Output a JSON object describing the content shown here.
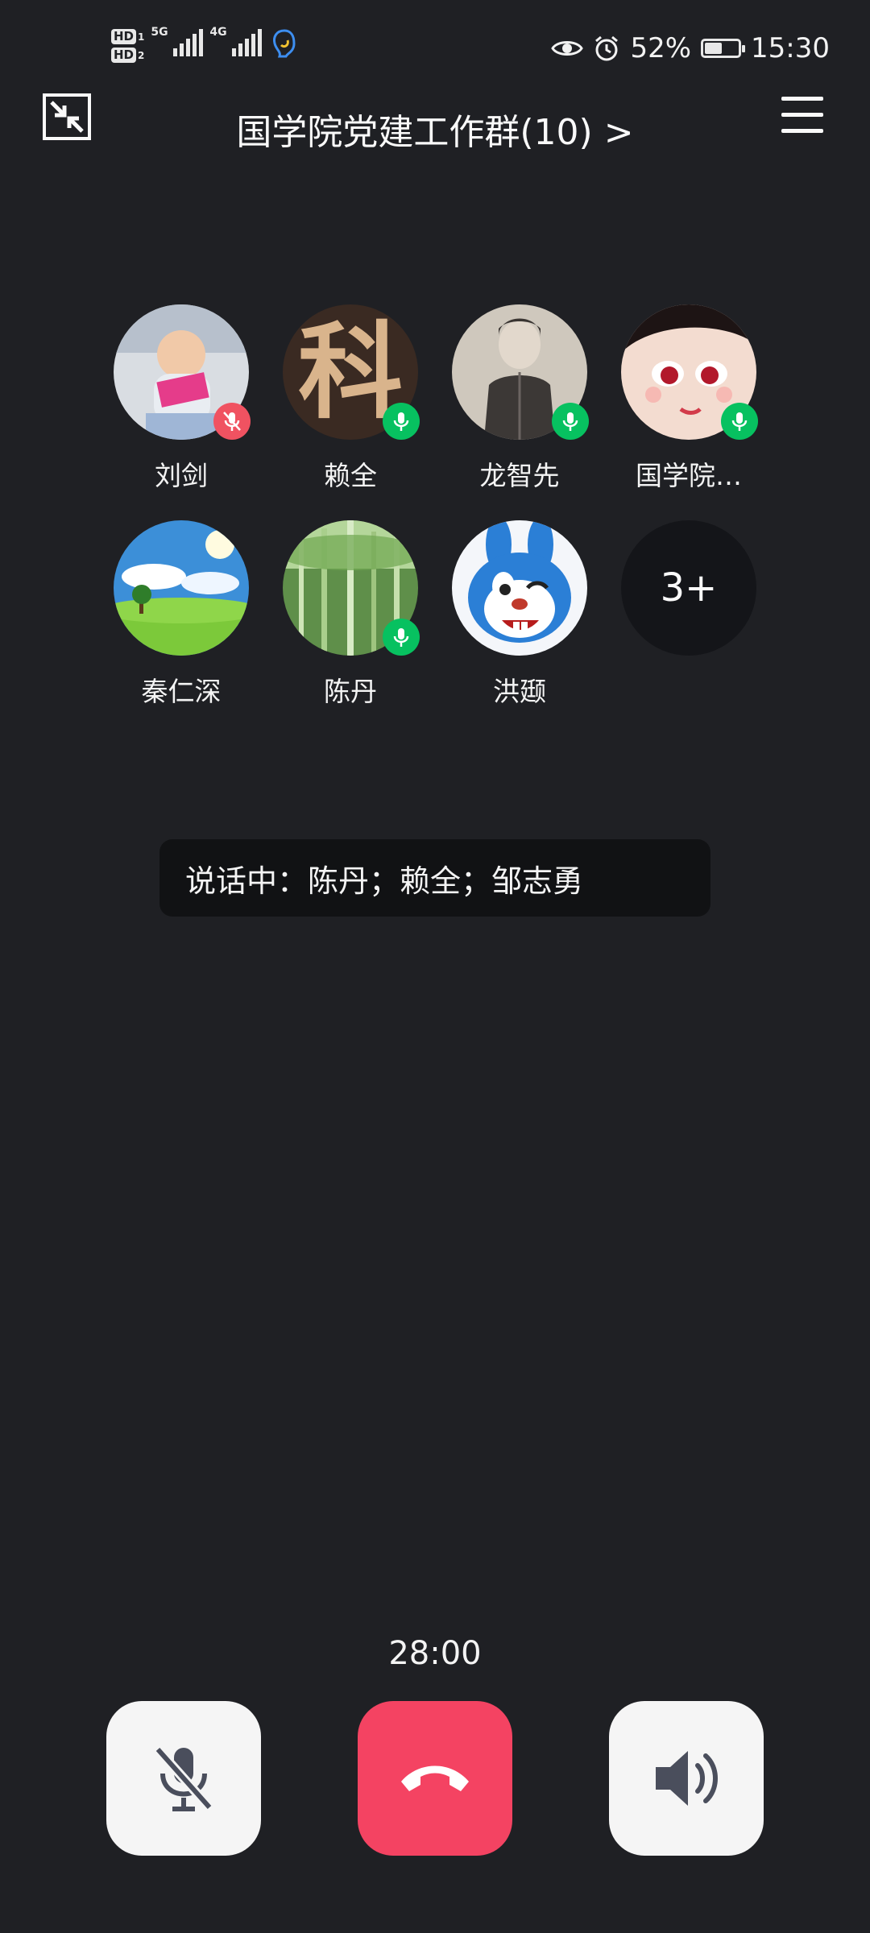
{
  "status_bar": {
    "hd1": "HD",
    "hd1_num": "1",
    "hd2": "HD",
    "hd2_num": "2",
    "net1": "5G",
    "net2": "4G",
    "battery_percent": "52%",
    "battery_level": 0.52,
    "time": "15:30",
    "icons": [
      "eye-icon",
      "alarm-icon",
      "battery-icon",
      "assistant-icon"
    ]
  },
  "header": {
    "title": "国学院党建工作群(10)",
    "title_chevron": ">",
    "left_icon": "minimize-icon",
    "right_icon": "menu-icon"
  },
  "participants": [
    {
      "name": "刘剑",
      "mic": "off"
    },
    {
      "name": "赖全",
      "mic": "on"
    },
    {
      "name": "龙智先",
      "mic": "on"
    },
    {
      "name": "国学院…",
      "mic": "on"
    },
    {
      "name": "秦仁深",
      "mic": "none"
    },
    {
      "name": "陈丹",
      "mic": "on"
    },
    {
      "name": "洪颋",
      "mic": "none"
    }
  ],
  "more": {
    "label": "3+"
  },
  "avatar_text": {
    "laiquan": "科"
  },
  "speaking": {
    "text": "说话中：陈丹；赖全；邹志勇"
  },
  "call": {
    "timer": "28:00"
  },
  "controls": {
    "mute_icon": "mic-off-icon",
    "hangup_icon": "hang-up-icon",
    "speaker_icon": "speaker-icon"
  },
  "colors": {
    "background": "#1f2024",
    "mic_on": "#07c160",
    "mic_off": "#f05261",
    "hangup": "#f44362"
  }
}
